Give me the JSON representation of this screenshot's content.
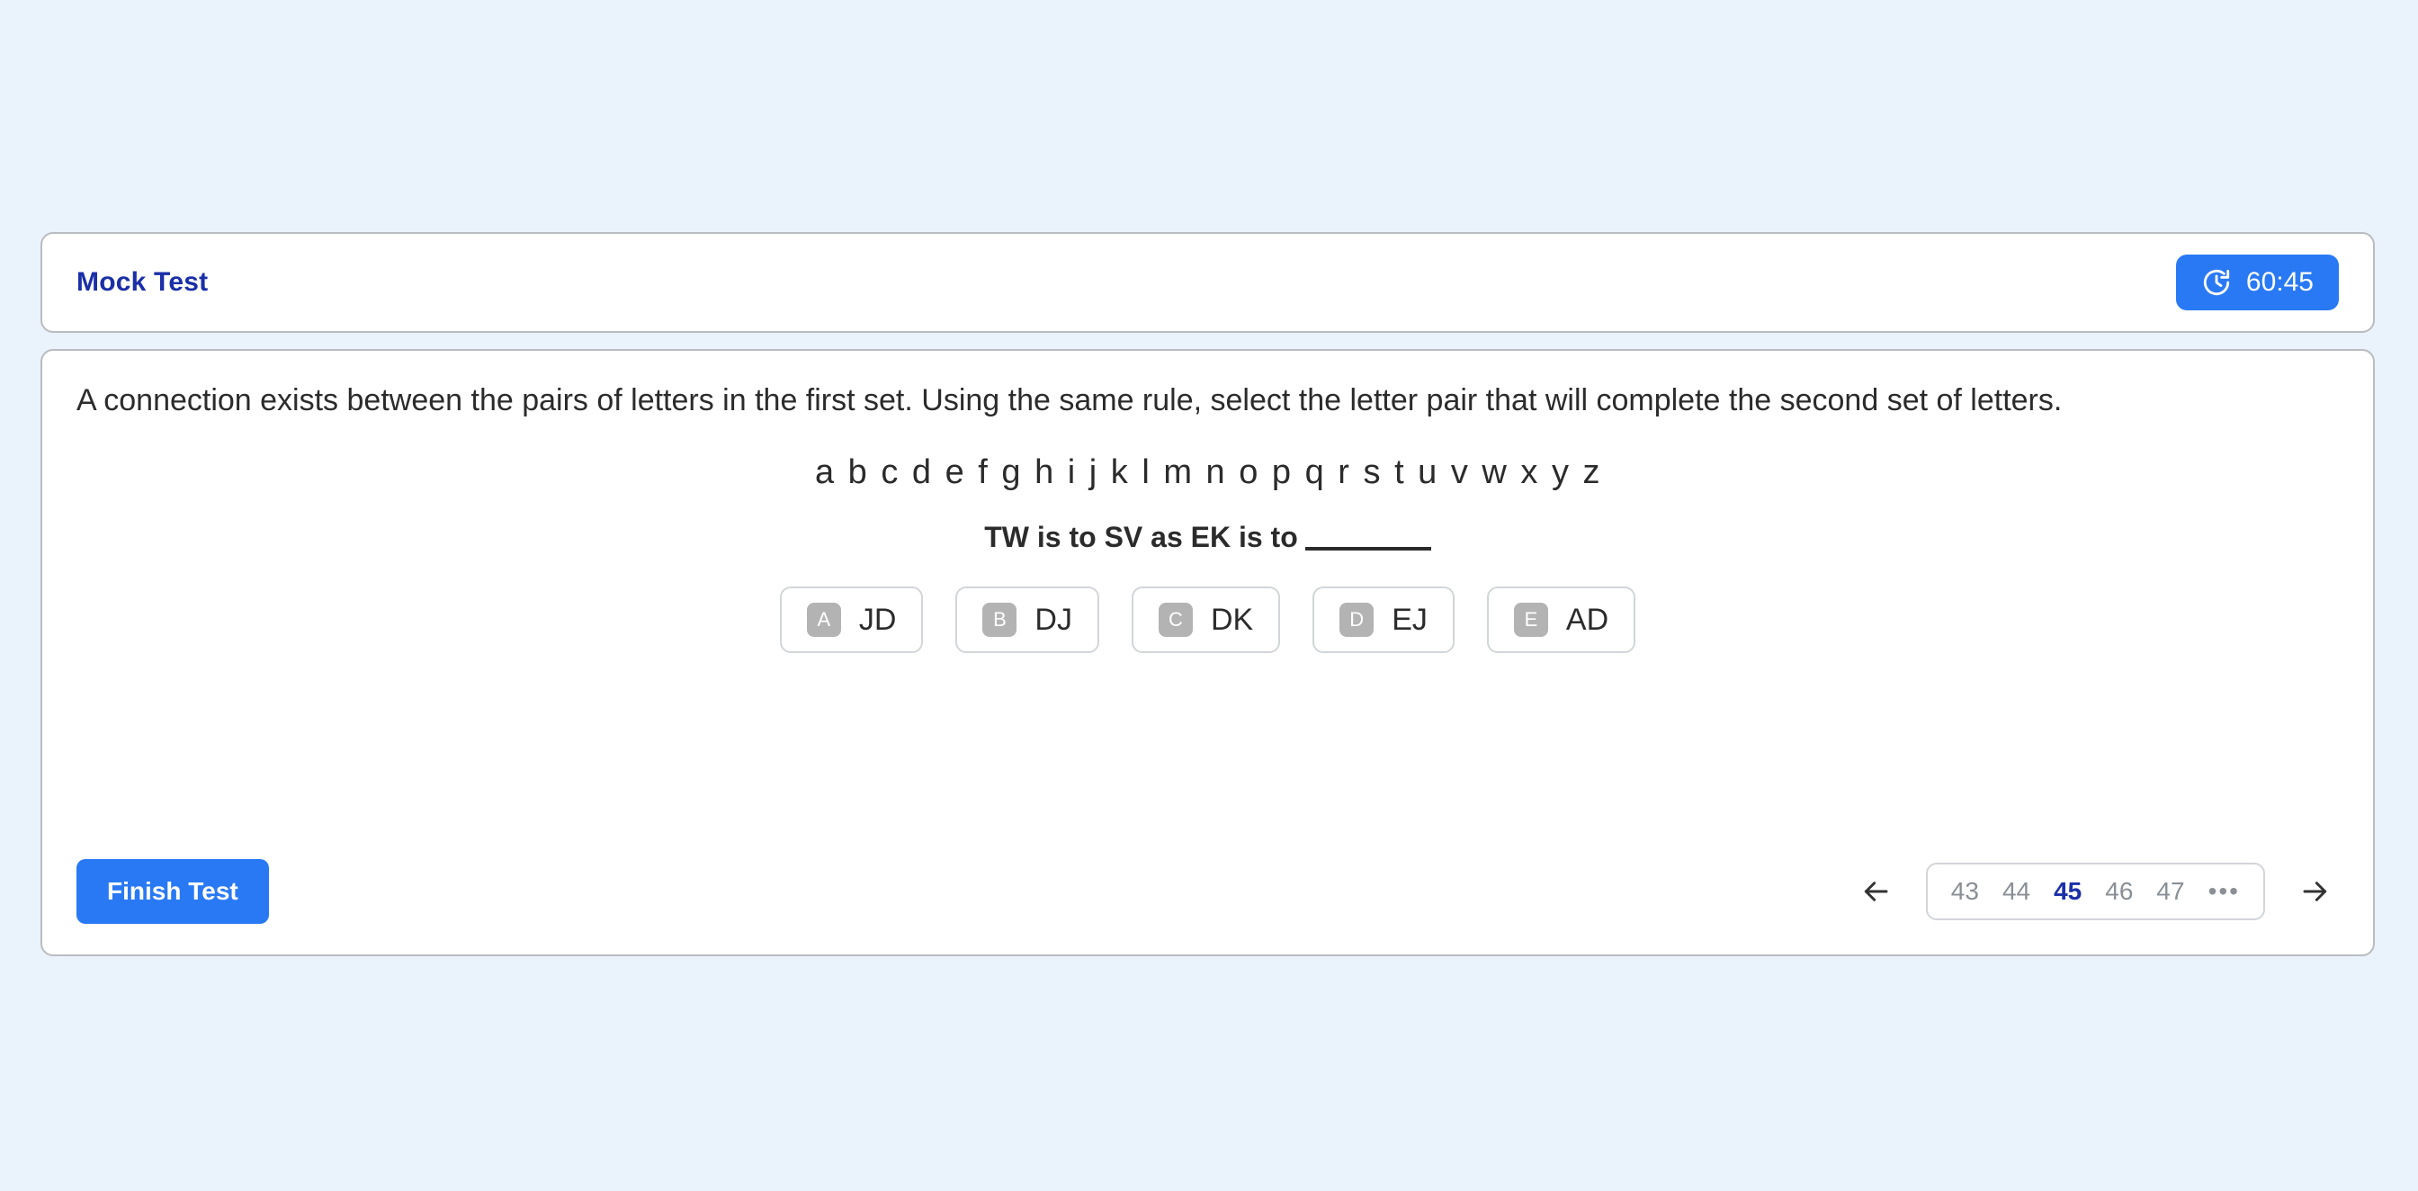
{
  "theme": {
    "background": "#eaf2fb",
    "accent_blue": "#2979f5",
    "title_blue": "#1a2fa8",
    "card_border": "#b9bcc0",
    "badge_gray": "#b3b3b3",
    "text_dark": "#2b2b2b",
    "muted_gray": "#8a8f96"
  },
  "header": {
    "title": "Mock Test",
    "timer": {
      "icon": "clock-icon",
      "value": "60:45"
    }
  },
  "question": {
    "prompt": "A connection exists between the pairs of letters in the first set. Using the same rule, select the letter pair that will complete the second set of letters.",
    "alphabet": "a b c d e f g h i j k l m n o p q r s t u v w x y z",
    "analogy": "TW is to SV as EK is to",
    "blank": "______",
    "options": [
      {
        "key": "A",
        "label": "JD"
      },
      {
        "key": "B",
        "label": "DJ"
      },
      {
        "key": "C",
        "label": "DK"
      },
      {
        "key": "D",
        "label": "EJ"
      },
      {
        "key": "E",
        "label": "AD"
      }
    ]
  },
  "footer": {
    "finish_label": "Finish Test",
    "prev_icon": "arrow-left-icon",
    "next_icon": "arrow-right-icon",
    "pages": [
      "43",
      "44",
      "45",
      "46",
      "47"
    ],
    "current_page": "45",
    "ellipsis": "•••"
  }
}
